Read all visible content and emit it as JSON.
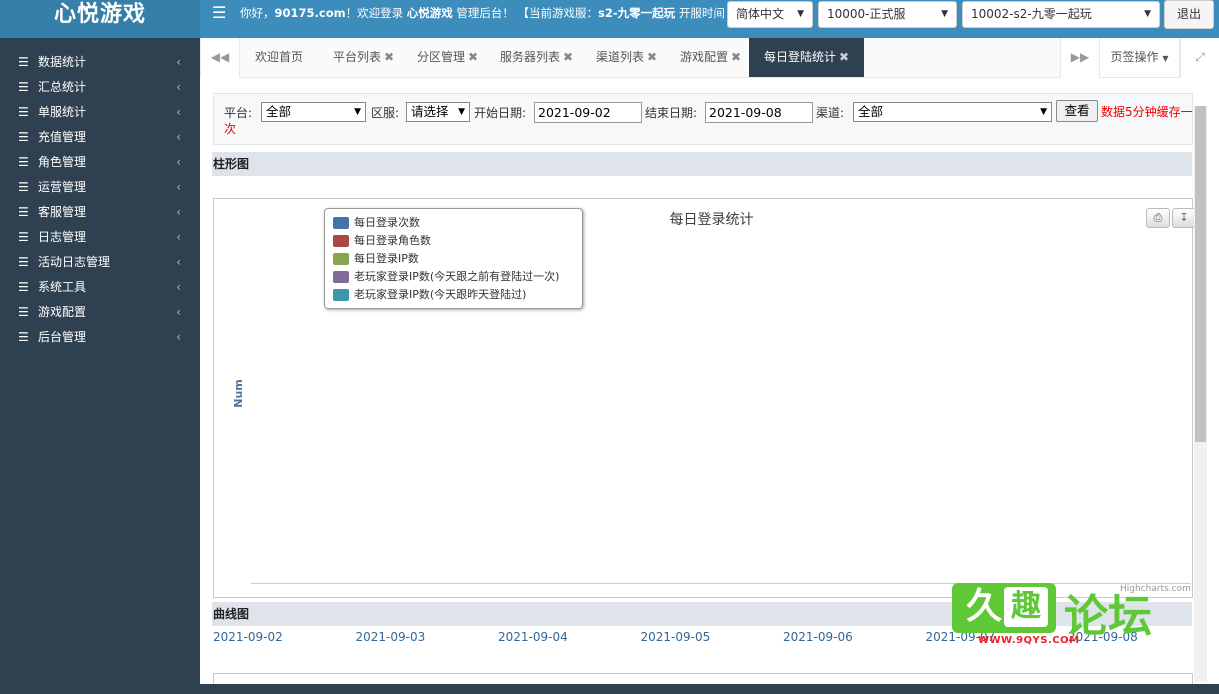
{
  "app": {
    "logo": "心悦游戏",
    "welcome_prefix": "你好，",
    "username": "90175.com",
    "welcome_mid": "！欢迎登录 ",
    "brand": "心悦游戏",
    "welcome_suffix": " 管理后台！ 【当前游戏服：",
    "server_name": "s2-九零一起玩",
    "welcome_tail": " 开服时间"
  },
  "topbar": {
    "language": "简体中文",
    "env": "10000-正式服",
    "server": "10002-s2-九零一起玩",
    "logout": "退出"
  },
  "sidebar": {
    "items": [
      {
        "label": "数据统计"
      },
      {
        "label": "汇总统计"
      },
      {
        "label": "单服统计"
      },
      {
        "label": "充值管理"
      },
      {
        "label": "角色管理"
      },
      {
        "label": "运营管理"
      },
      {
        "label": "客服管理"
      },
      {
        "label": "日志管理"
      },
      {
        "label": "活动日志管理"
      },
      {
        "label": "系统工具"
      },
      {
        "label": "游戏配置"
      },
      {
        "label": "后台管理"
      }
    ]
  },
  "tabs": {
    "items": [
      {
        "label": "欢迎首页"
      },
      {
        "label": "平台列表"
      },
      {
        "label": "分区管理"
      },
      {
        "label": "服务器列表"
      },
      {
        "label": "渠道列表"
      },
      {
        "label": "游戏配置"
      },
      {
        "label": "每日登陆统计"
      }
    ],
    "page_ops": "页签操作"
  },
  "filter": {
    "platform_label": "平台:",
    "platform_value": "全部",
    "zone_label": "区服:",
    "zone_value": "请选择",
    "start_label": "开始日期:",
    "start_value": "2021-09-02",
    "end_label": "结束日期:",
    "end_value": "2021-09-08",
    "channel_label": "渠道:",
    "channel_value": "全部",
    "query_button": "查看",
    "cache_note": "数据5分钟缓存一次"
  },
  "bar_section": {
    "heading": "柱形图"
  },
  "chart_data": {
    "type": "bar",
    "title": "每日登录统计",
    "ylabel": "Num",
    "xlabel": "",
    "credits": "Highcharts.com",
    "series": [
      {
        "name": "每日登录次数",
        "color": "#4572a7",
        "values": []
      },
      {
        "name": "每日登录角色数",
        "color": "#aa4643",
        "values": []
      },
      {
        "name": "每日登录IP数",
        "color": "#89a54e",
        "values": []
      },
      {
        "name": "老玩家登录IP数(今天跟之前有登陆过一次)",
        "color": "#80699b",
        "values": []
      },
      {
        "name": "老玩家登录IP数(今天跟昨天登陆过)",
        "color": "#3d96ae",
        "values": []
      }
    ],
    "legend_position": "top-left"
  },
  "line_section": {
    "heading": "曲线图",
    "dates": [
      "2021-09-02",
      "2021-09-03",
      "2021-09-04",
      "2021-09-05",
      "2021-09-06",
      "2021-09-07",
      "2021-09-08"
    ]
  },
  "watermark": {
    "box_left": "久",
    "box_right": "趣",
    "text": "论坛",
    "url": "WWW.9QYS.COM"
  }
}
